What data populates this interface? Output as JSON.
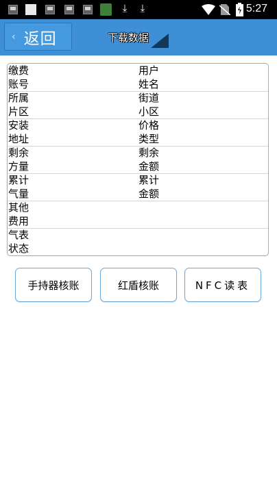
{
  "status_bar": {
    "time": "5:27",
    "icons": [
      "notification-icon",
      "notification-icon",
      "notification-icon",
      "notification-icon",
      "notification-icon",
      "app-icon",
      "download-icon",
      "download-icon",
      "wifi-icon",
      "no-sim-icon",
      "battery-icon"
    ]
  },
  "header": {
    "back_chevron": "‹",
    "back_label": "返回",
    "download_label": "下载数据",
    "background": "#3e8fd6"
  },
  "info_rows": [
    {
      "left": "缴费账号",
      "right": "用户姓名"
    },
    {
      "left": "所属片区",
      "right": "街道小区"
    },
    {
      "left": "安装地址",
      "right": "价格类型"
    },
    {
      "left": "剩余方量",
      "right": "剩余金额"
    },
    {
      "left": "累计气量",
      "right": "累计金额"
    },
    {
      "left": "其他费用",
      "right": ""
    },
    {
      "left": "气表状态",
      "right": ""
    }
  ],
  "actions": {
    "handheld": "手持器核账",
    "hongdun": "红盾核账",
    "nfc": "NFC读表"
  }
}
